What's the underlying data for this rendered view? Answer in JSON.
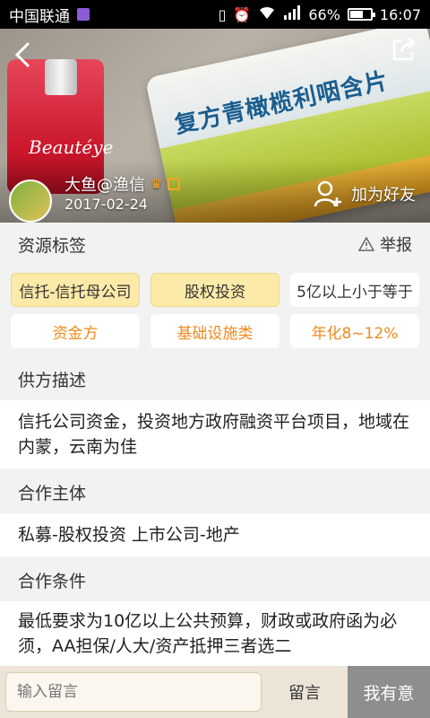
{
  "status_bar": {
    "carrier": "中国联通",
    "battery": "66%",
    "battery_level": 0.66,
    "time": "16:07"
  },
  "hero": {
    "bottle_text": "Beautéye",
    "box_title": "复方青橄榄利咽含片",
    "user_name": "大鱼@渔信",
    "user_date": "2017-02-24",
    "add_friend": "加为好友"
  },
  "resource_tags": {
    "title": "资源标签",
    "report": "举报",
    "tags": [
      {
        "label": "信托-信托母公司",
        "style": "filled"
      },
      {
        "label": "股权投资",
        "style": "filled"
      },
      {
        "label": "5亿以上小于等于",
        "style": "plain"
      },
      {
        "label": "资金方",
        "style": "orange"
      },
      {
        "label": "基础设施类",
        "style": "orange"
      },
      {
        "label": "年化8~12%",
        "style": "orange"
      }
    ]
  },
  "supply_desc": {
    "title": "供方描述",
    "text": "信托公司资金，投资地方政府融资平台项目，地域在内蒙，云南为佳"
  },
  "partner": {
    "title": "合作主体",
    "text": "私募-股权投资  上市公司-地产"
  },
  "conditions": {
    "title": "合作条件",
    "text": "最低要求为10亿以上公共预算，财政或政府函为必须，AA担保/人大/资产抵押三者选二"
  },
  "bottom_bar": {
    "input_placeholder": "输入留言",
    "comment_button": "留言",
    "intent_button": "我有意"
  },
  "colors": {
    "tag_orange": "#f08a1c",
    "tag_filled": "#fbeaa8",
    "intent_button": "#8e8e8e"
  }
}
